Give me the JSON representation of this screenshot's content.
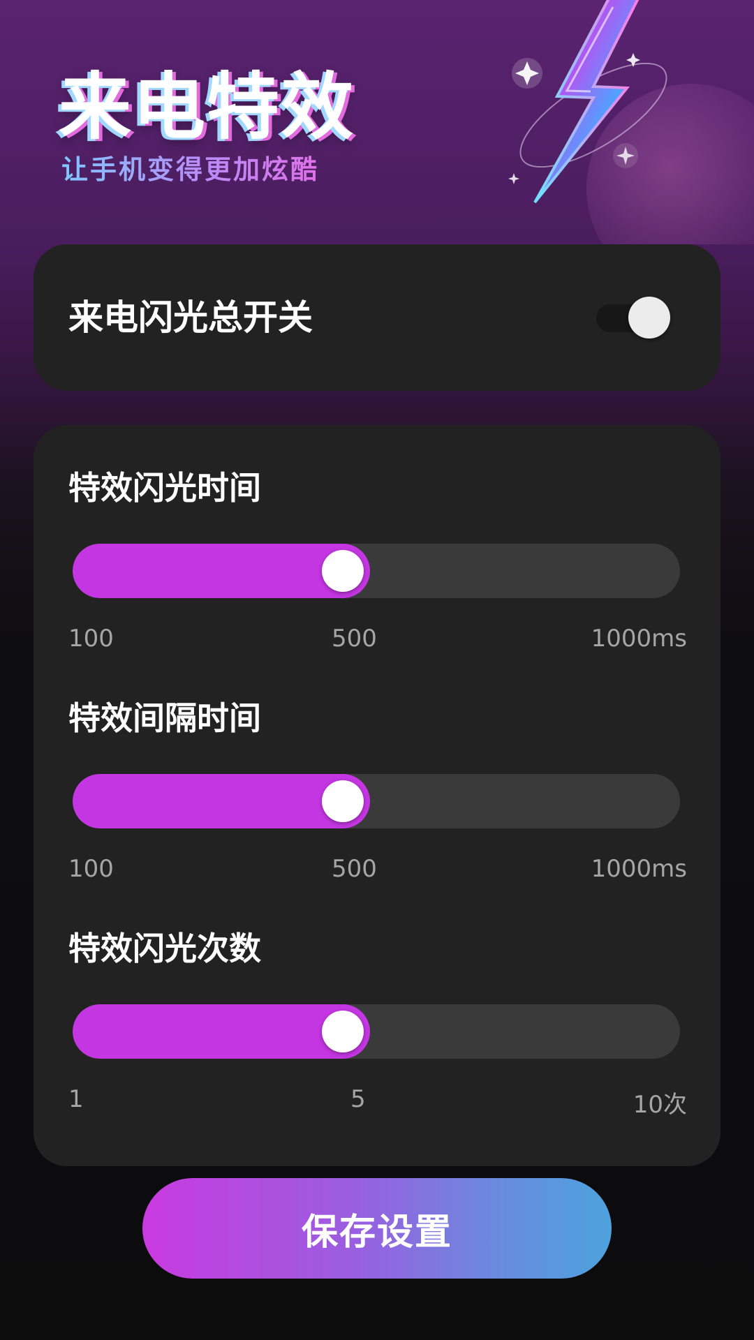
{
  "hero": {
    "title": "来电特效",
    "subtitle": "让手机变得更加炫酷"
  },
  "master": {
    "label": "来电闪光总开关",
    "enabled": false
  },
  "settings": [
    {
      "title": "特效闪光时间",
      "value": 500,
      "min": 100,
      "max": 1000,
      "fill_fraction": 0.49,
      "ticks": [
        "100",
        "500",
        "1000ms"
      ]
    },
    {
      "title": "特效间隔时间",
      "value": 500,
      "min": 100,
      "max": 1000,
      "fill_fraction": 0.49,
      "ticks": [
        "100",
        "500",
        "1000ms"
      ]
    },
    {
      "title": "特效闪光次数",
      "value": 5,
      "min": 1,
      "max": 10,
      "fill_fraction": 0.49,
      "ticks": [
        "1",
        "5",
        "10次"
      ]
    }
  ],
  "save": {
    "label": "保存设置"
  },
  "colors": {
    "accent": "#c436e2",
    "track": "#3a3a3a",
    "card": "#222222",
    "button_gradient_start": "#c93ae0",
    "button_gradient_end": "#4ea2dd"
  },
  "icons": {
    "hero_graphic": "lightning-bolt-icon"
  }
}
